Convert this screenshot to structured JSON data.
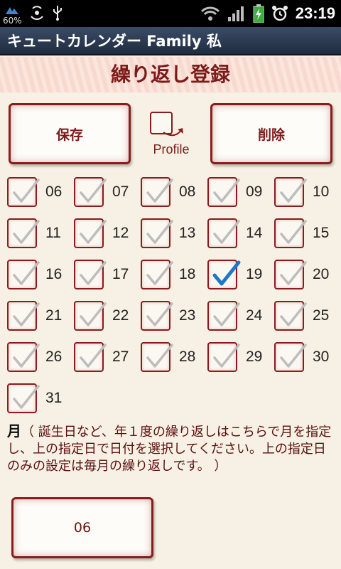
{
  "status_bar": {
    "battery_percent": "60%",
    "time": "23:19"
  },
  "app": {
    "title": "キュートカレンダー Family 私"
  },
  "page": {
    "title": "繰り返し登録"
  },
  "toolbar": {
    "save_label": "保存",
    "delete_label": "削除",
    "profile_label": "Profile"
  },
  "days": [
    {
      "label": "06",
      "checked": false
    },
    {
      "label": "07",
      "checked": false
    },
    {
      "label": "08",
      "checked": false
    },
    {
      "label": "09",
      "checked": false
    },
    {
      "label": "10",
      "checked": false
    },
    {
      "label": "11",
      "checked": false
    },
    {
      "label": "12",
      "checked": false
    },
    {
      "label": "13",
      "checked": false
    },
    {
      "label": "14",
      "checked": false
    },
    {
      "label": "15",
      "checked": false
    },
    {
      "label": "16",
      "checked": false
    },
    {
      "label": "17",
      "checked": false
    },
    {
      "label": "18",
      "checked": false
    },
    {
      "label": "19",
      "checked": true
    },
    {
      "label": "20",
      "checked": false
    },
    {
      "label": "21",
      "checked": false
    },
    {
      "label": "22",
      "checked": false
    },
    {
      "label": "23",
      "checked": false
    },
    {
      "label": "24",
      "checked": false
    },
    {
      "label": "25",
      "checked": false
    },
    {
      "label": "26",
      "checked": false
    },
    {
      "label": "27",
      "checked": false
    },
    {
      "label": "28",
      "checked": false
    },
    {
      "label": "29",
      "checked": false
    },
    {
      "label": "30",
      "checked": false
    },
    {
      "label": "31",
      "checked": false
    }
  ],
  "note": {
    "month_word": "月",
    "text": "（ 誕生日など、年１度の繰り返しはこちらで月を指定し、上の指定日で日付を選択してください。上の指定日のみの設定は毎月の繰り返しです。 ）"
  },
  "month_select": {
    "value": "06"
  },
  "colors": {
    "accent": "#8a1c1c",
    "check_active": "#1e78c8",
    "check_inactive": "#bdbdbd"
  }
}
